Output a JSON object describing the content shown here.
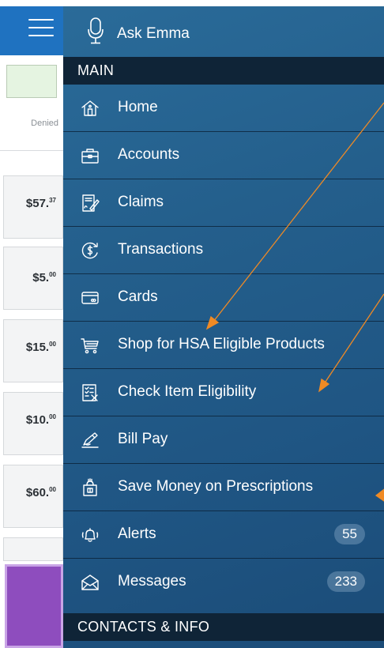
{
  "background_app": {
    "denied_label": "Denied",
    "amounts": [
      {
        "main": "$57.",
        "cents": "37"
      },
      {
        "main": "$5.",
        "cents": "00"
      },
      {
        "main": "$15.",
        "cents": "00"
      },
      {
        "main": "$10.",
        "cents": "00"
      },
      {
        "main": "$60.",
        "cents": "00"
      }
    ]
  },
  "menu": {
    "ask_emma": "Ask Emma",
    "main_header": "MAIN",
    "items": [
      {
        "label": "Home",
        "icon": "home-icon"
      },
      {
        "label": "Accounts",
        "icon": "briefcase-icon"
      },
      {
        "label": "Claims",
        "icon": "claims-form-icon"
      },
      {
        "label": "Transactions",
        "icon": "dollar-circle-icon"
      },
      {
        "label": "Cards",
        "icon": "credit-card-icon"
      },
      {
        "label": "Shop for HSA Eligible Products",
        "icon": "shopping-cart-icon"
      },
      {
        "label": "Check Item Eligibility",
        "icon": "checklist-icon"
      },
      {
        "label": "Bill Pay",
        "icon": "pen-paper-icon"
      },
      {
        "label": "Save Money on Prescriptions",
        "icon": "prescription-bag-icon"
      },
      {
        "label": "Alerts",
        "icon": "bell-icon",
        "badge": "55"
      },
      {
        "label": "Messages",
        "icon": "envelope-icon",
        "badge": "233"
      }
    ],
    "contacts_header": "CONTACTS & INFO"
  },
  "colors": {
    "header_blue": "#1f72c0",
    "menu_blue": "#245f8c",
    "section_dark": "#0f2437",
    "annotation_orange": "#f08a24",
    "purple": "#8e4dbe"
  }
}
